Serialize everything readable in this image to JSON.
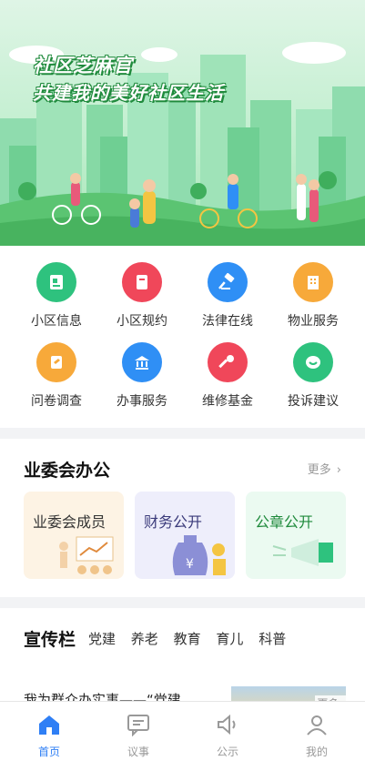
{
  "banner": {
    "slogan_line1": "社区芝麻官",
    "slogan_line2": "共建我的美好社区生活"
  },
  "grid": {
    "items": [
      {
        "label": "小区信息",
        "icon": "document-icon",
        "color": "#2ec27e"
      },
      {
        "label": "小区规约",
        "icon": "book-icon",
        "color": "#f0475a"
      },
      {
        "label": "法律在线",
        "icon": "gavel-icon",
        "color": "#2f8ff5"
      },
      {
        "label": "物业服务",
        "icon": "building-icon",
        "color": "#f7a93a"
      },
      {
        "label": "问卷调查",
        "icon": "survey-icon",
        "color": "#f7a93a"
      },
      {
        "label": "办事服务",
        "icon": "bank-icon",
        "color": "#2f8ff5"
      },
      {
        "label": "维修基金",
        "icon": "wrench-icon",
        "color": "#f0475a"
      },
      {
        "label": "投诉建议",
        "icon": "chat-icon",
        "color": "#2ec27e"
      }
    ]
  },
  "committee": {
    "title": "业委会办公",
    "more": "更多",
    "tiles": [
      {
        "label": "业委会成员"
      },
      {
        "label": "财务公开"
      },
      {
        "label": "公章公开"
      }
    ]
  },
  "publicity": {
    "title": "宣传栏",
    "tabs": [
      "党建",
      "养老",
      "教育",
      "育儿",
      "科普"
    ],
    "news_title": "我为群众办实事——“党建",
    "more": "更多"
  },
  "tabbar": {
    "items": [
      {
        "label": "首页",
        "icon": "home-icon",
        "active": true
      },
      {
        "label": "议事",
        "icon": "message-icon",
        "active": false
      },
      {
        "label": "公示",
        "icon": "speaker-icon",
        "active": false
      },
      {
        "label": "我的",
        "icon": "user-icon",
        "active": false
      }
    ]
  },
  "colors": {
    "accent": "#2f7ff5",
    "banner_green": "#1f8a3c"
  }
}
